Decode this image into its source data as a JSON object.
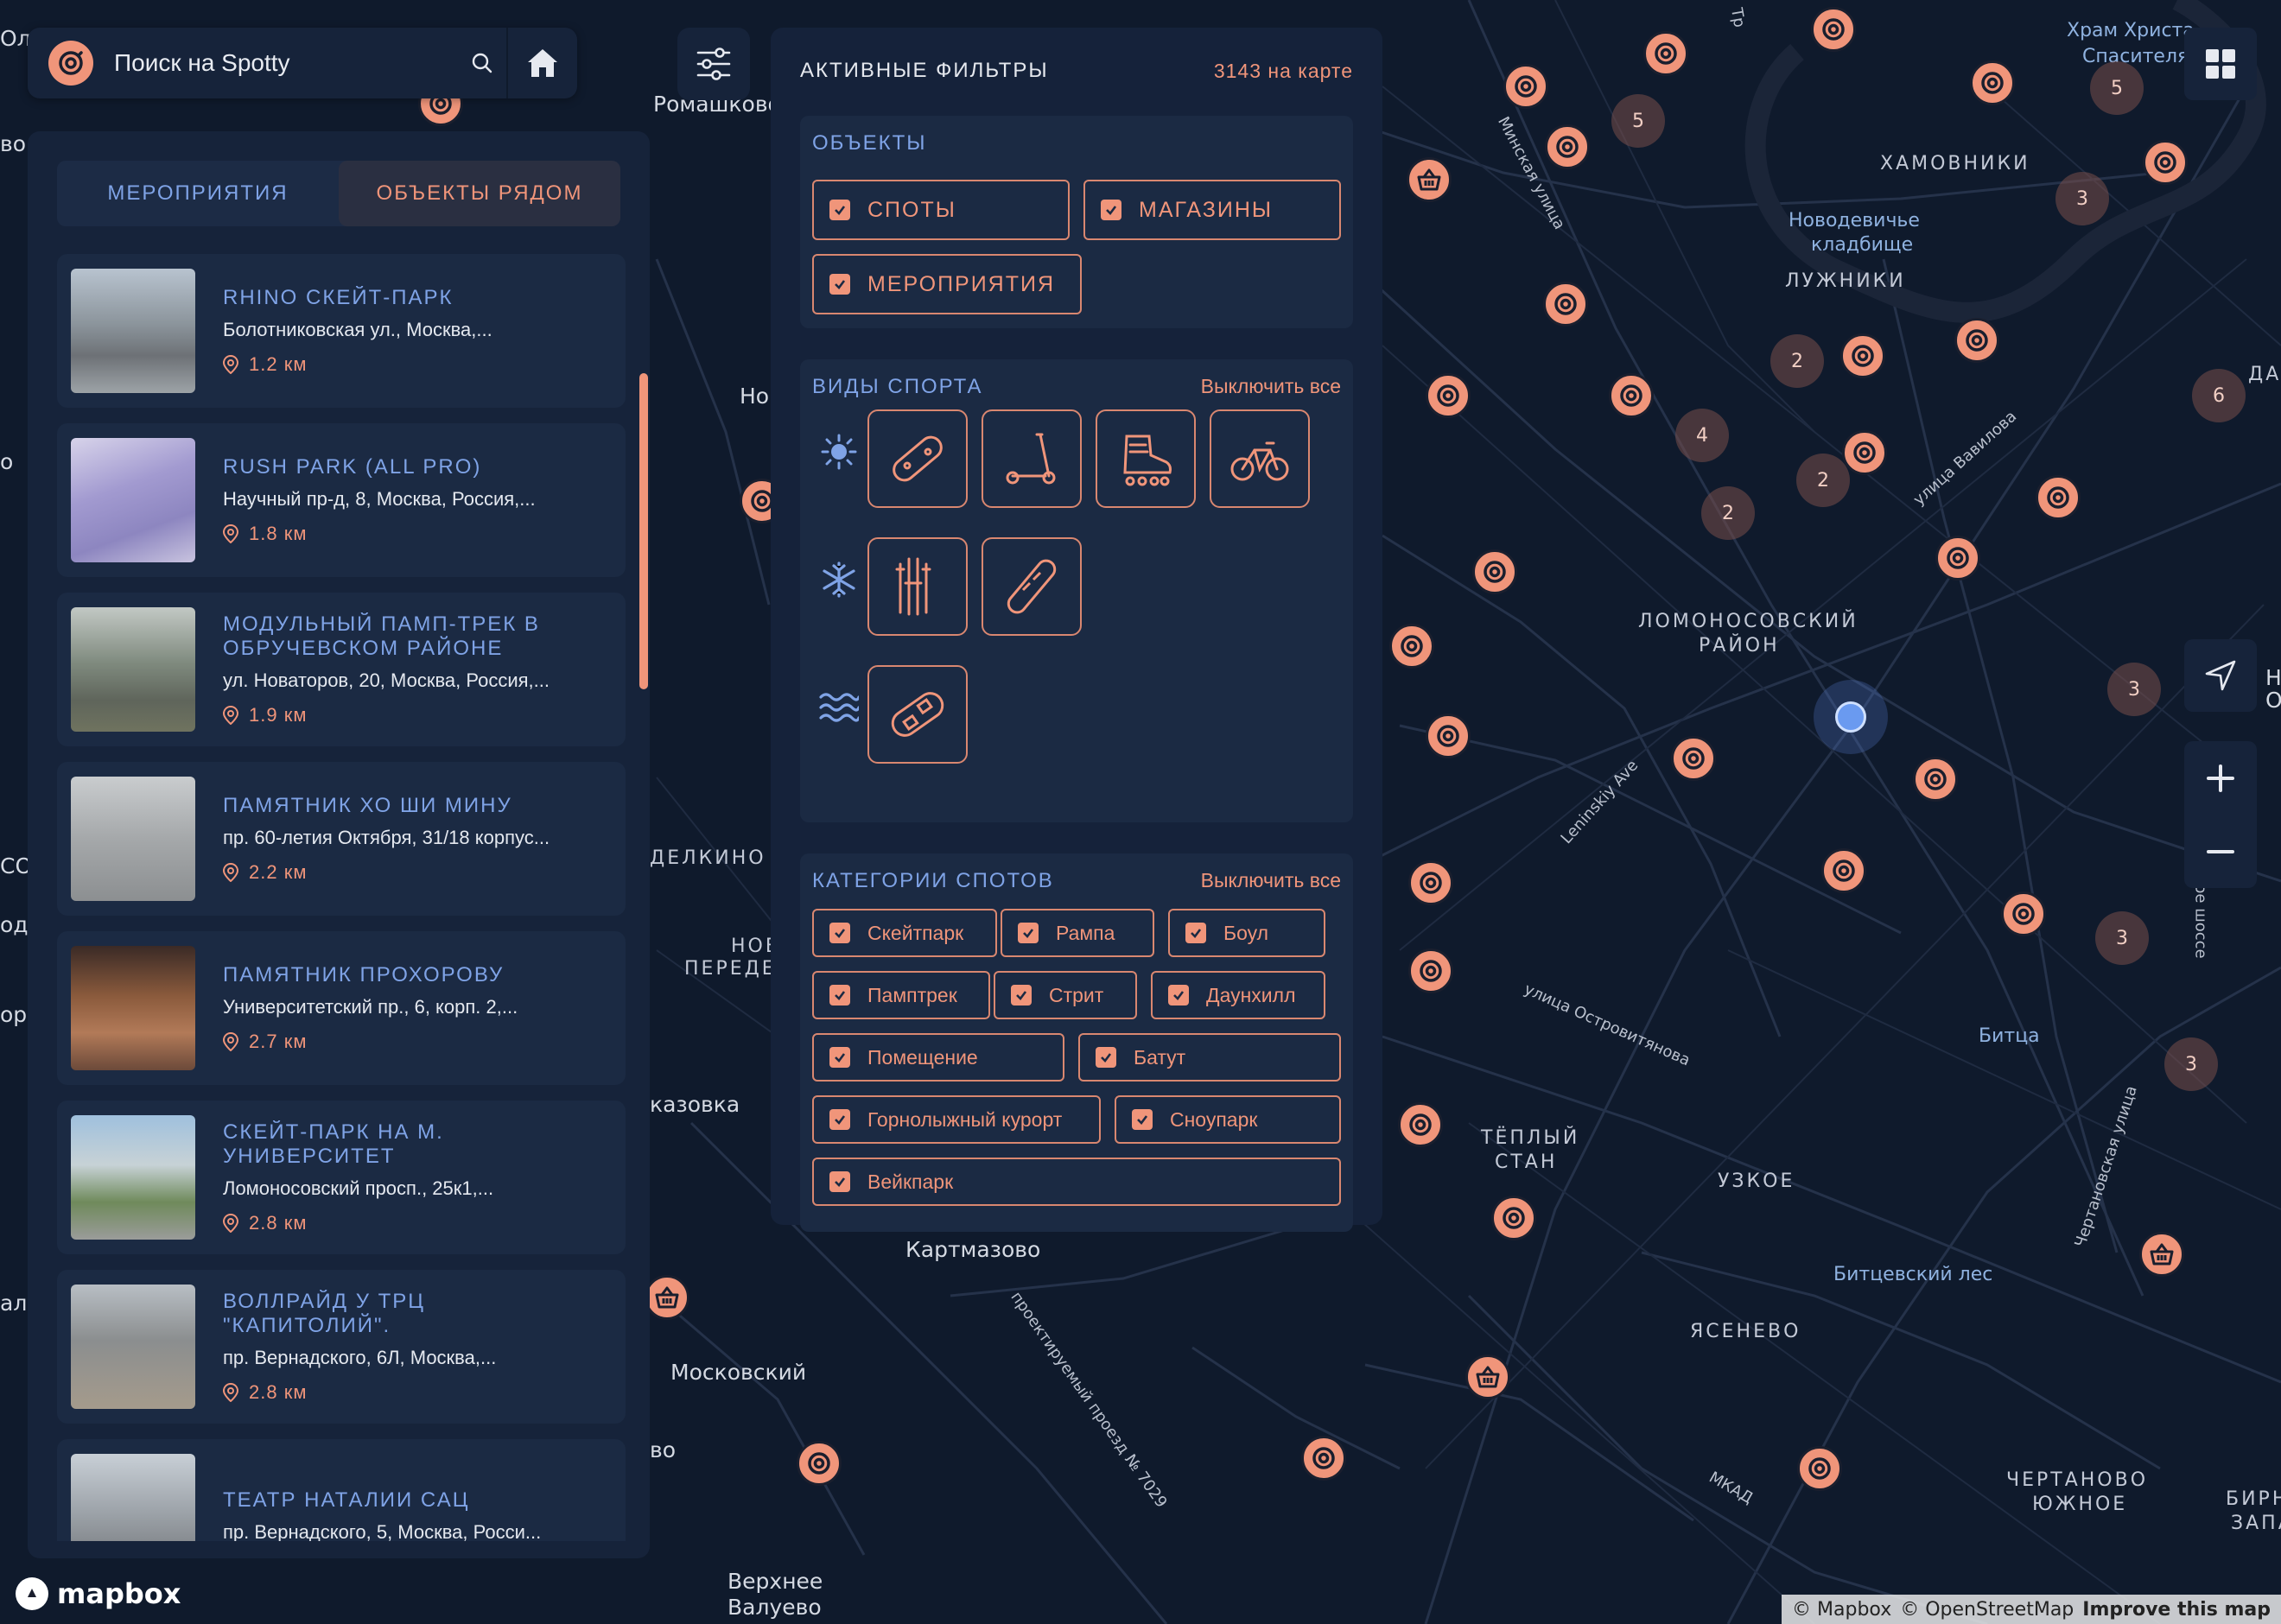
{
  "search": {
    "placeholder": "Поиск на Spotty"
  },
  "tabs": [
    {
      "label": "МЕРОПРИЯТИЯ"
    },
    {
      "label": "ОБЪЕКТЫ РЯДОМ"
    }
  ],
  "results": [
    {
      "title": "RHINO СКЕЙТ-ПАРК",
      "address": "Болотниковская ул., Москва,...",
      "distance": "1.2 км"
    },
    {
      "title": "RUSH PARK (ALL PRO)",
      "address": "Научный пр-д, 8, Москва, Россия,...",
      "distance": "1.8 км"
    },
    {
      "title": "МОДУЛЬНЫЙ ПАМП-ТРЕК В ОБРУЧЕВСКОМ РАЙОНЕ",
      "address": "ул. Новаторов, 20, Москва, Россия,...",
      "distance": "1.9 км"
    },
    {
      "title": "ПАМЯТНИК ХО ШИ МИНУ",
      "address": "пр. 60-летия Октября, 31/18 корпус...",
      "distance": "2.2 км"
    },
    {
      "title": "ПАМЯТНИК ПРОХОРОВУ",
      "address": "Университетский пр., 6, корп. 2,...",
      "distance": "2.7 км"
    },
    {
      "title": "СКЕЙТ-ПАРК НА М. УНИВЕРСИТЕТ",
      "address": "Ломоносовский просп., 25к1,...",
      "distance": "2.8 км"
    },
    {
      "title": "ВОЛЛРАЙД У ТРЦ \"КАПИТОЛИЙ\".",
      "address": "пр. Вернадского, 6Л, Москва,...",
      "distance": "2.8 км"
    },
    {
      "title": "ТЕАТР НАТАЛИИ САЦ",
      "address": "пр. Вернадского, 5, Москва, Росси...",
      "distance": ""
    }
  ],
  "filters": {
    "title": "АКТИВНЫЕ ФИЛЬТРЫ",
    "count": "3143 на карте",
    "objects": {
      "title": "ОБЪЕКТЫ",
      "items": [
        "СПОТЫ",
        "МАГАЗИНЫ",
        "МЕРОПРИЯТИЯ"
      ]
    },
    "sports": {
      "title": "ВИДЫ СПОРТА",
      "toggle_all": "Выключить все"
    },
    "categories": {
      "title": "КАТЕГОРИИ СПОТОВ",
      "toggle_all": "Выключить все",
      "items": [
        "Скейтпарк",
        "Рампа",
        "Боул",
        "Памптрек",
        "Стрит",
        "Даунхилл",
        "Помещение",
        "Батут",
        "Горнолыжный курорт",
        "Сноупарк",
        "Вейкпарк"
      ]
    }
  },
  "map_labels": {
    "romashkovo": "Ромашково",
    "khram_1": "Храм Христа",
    "khram_2": "Спасителя",
    "khamovniki": "ХАМОВНИКИ",
    "novodev_1": "Новодевичье",
    "novodev_2": "кладбище",
    "luzhniki": "ЛУЖНИКИ",
    "lomonosov_1": "ЛОМОНОСОВСКИЙ",
    "lomonosov_2": "РАЙОН",
    "minskaya": "Минская улица",
    "vavilova": "улица Вавилова",
    "leninsky": "Leninskiy Ave",
    "ostrovityanova": "улица Островитянова",
    "bitsa": "Битца",
    "teply_1": "ТЁПЛЫЙ",
    "teply_2": "СТАН",
    "uzkoe": "УЗКОЕ",
    "bitsevsky": "Битцевский лес",
    "yasenevo": "ЯСЕНЕВО",
    "kartmazovo": "Картмазово",
    "moskovsky": "Московский",
    "proezd": "проектируемый проезд № 7029",
    "mkad": "МКАД",
    "chertanovskaya": "Чертановская улица",
    "chertanovo_1": "ЧЕРТАНОВО",
    "chertanovo_2": "ЮЖНОЕ",
    "verkhnee_1": "Верхнее",
    "verkhnee_2": "Валуево",
    "shosse": "ое шоссе",
    "dan": "ДАН",
    "birn_1": "БИРН",
    "birn_2": "ЗАПА",
    "no": "Но",
    "delkino": "ДЕЛКИНО",
    "nove_1": "НОВЕ",
    "nove_2": "ПЕРЕДЕ",
    "kazovka": "казовка",
    "bo": "во",
    "edge_ola": "Ола",
    "edge_vo": "во",
    "edge_o": "о",
    "edge_co": "СО",
    "edge_odzh": "одж",
    "edge_orp": "орп",
    "edge_al": "ал",
    "edge_n": "Н",
    "edge_o2": "О",
    "tr": "Тр"
  },
  "clusters": [
    "5",
    "5",
    "3",
    "2",
    "4",
    "2",
    "2",
    "6",
    "3",
    "3",
    "3"
  ],
  "attribution": {
    "mapbox": "© Mapbox",
    "osm": "© OpenStreetMap",
    "improve": "Improve this map"
  },
  "logo_text": "mapbox",
  "colors": {
    "accent": "#f0957a",
    "blue": "#7fa3e6",
    "panel": "#16233a",
    "map_bg": "#0f1a2c"
  }
}
